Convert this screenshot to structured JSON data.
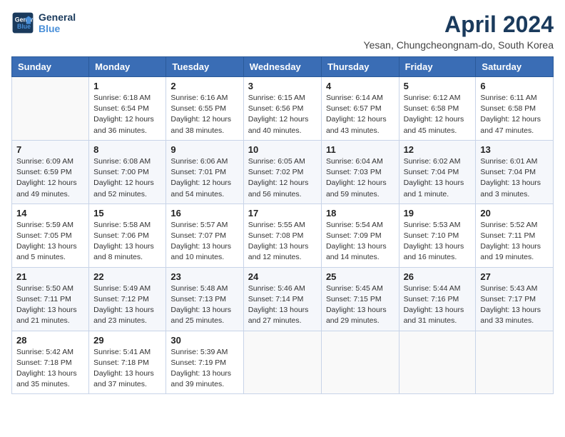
{
  "logo": {
    "line1": "General",
    "line2": "Blue"
  },
  "title": "April 2024",
  "subtitle": "Yesan, Chungcheongnam-do, South Korea",
  "days_of_week": [
    "Sunday",
    "Monday",
    "Tuesday",
    "Wednesday",
    "Thursday",
    "Friday",
    "Saturday"
  ],
  "weeks": [
    [
      {
        "num": "",
        "info": ""
      },
      {
        "num": "1",
        "info": "Sunrise: 6:18 AM\nSunset: 6:54 PM\nDaylight: 12 hours\nand 36 minutes."
      },
      {
        "num": "2",
        "info": "Sunrise: 6:16 AM\nSunset: 6:55 PM\nDaylight: 12 hours\nand 38 minutes."
      },
      {
        "num": "3",
        "info": "Sunrise: 6:15 AM\nSunset: 6:56 PM\nDaylight: 12 hours\nand 40 minutes."
      },
      {
        "num": "4",
        "info": "Sunrise: 6:14 AM\nSunset: 6:57 PM\nDaylight: 12 hours\nand 43 minutes."
      },
      {
        "num": "5",
        "info": "Sunrise: 6:12 AM\nSunset: 6:58 PM\nDaylight: 12 hours\nand 45 minutes."
      },
      {
        "num": "6",
        "info": "Sunrise: 6:11 AM\nSunset: 6:58 PM\nDaylight: 12 hours\nand 47 minutes."
      }
    ],
    [
      {
        "num": "7",
        "info": "Sunrise: 6:09 AM\nSunset: 6:59 PM\nDaylight: 12 hours\nand 49 minutes."
      },
      {
        "num": "8",
        "info": "Sunrise: 6:08 AM\nSunset: 7:00 PM\nDaylight: 12 hours\nand 52 minutes."
      },
      {
        "num": "9",
        "info": "Sunrise: 6:06 AM\nSunset: 7:01 PM\nDaylight: 12 hours\nand 54 minutes."
      },
      {
        "num": "10",
        "info": "Sunrise: 6:05 AM\nSunset: 7:02 PM\nDaylight: 12 hours\nand 56 minutes."
      },
      {
        "num": "11",
        "info": "Sunrise: 6:04 AM\nSunset: 7:03 PM\nDaylight: 12 hours\nand 59 minutes."
      },
      {
        "num": "12",
        "info": "Sunrise: 6:02 AM\nSunset: 7:04 PM\nDaylight: 13 hours\nand 1 minute."
      },
      {
        "num": "13",
        "info": "Sunrise: 6:01 AM\nSunset: 7:04 PM\nDaylight: 13 hours\nand 3 minutes."
      }
    ],
    [
      {
        "num": "14",
        "info": "Sunrise: 5:59 AM\nSunset: 7:05 PM\nDaylight: 13 hours\nand 5 minutes."
      },
      {
        "num": "15",
        "info": "Sunrise: 5:58 AM\nSunset: 7:06 PM\nDaylight: 13 hours\nand 8 minutes."
      },
      {
        "num": "16",
        "info": "Sunrise: 5:57 AM\nSunset: 7:07 PM\nDaylight: 13 hours\nand 10 minutes."
      },
      {
        "num": "17",
        "info": "Sunrise: 5:55 AM\nSunset: 7:08 PM\nDaylight: 13 hours\nand 12 minutes."
      },
      {
        "num": "18",
        "info": "Sunrise: 5:54 AM\nSunset: 7:09 PM\nDaylight: 13 hours\nand 14 minutes."
      },
      {
        "num": "19",
        "info": "Sunrise: 5:53 AM\nSunset: 7:10 PM\nDaylight: 13 hours\nand 16 minutes."
      },
      {
        "num": "20",
        "info": "Sunrise: 5:52 AM\nSunset: 7:11 PM\nDaylight: 13 hours\nand 19 minutes."
      }
    ],
    [
      {
        "num": "21",
        "info": "Sunrise: 5:50 AM\nSunset: 7:11 PM\nDaylight: 13 hours\nand 21 minutes."
      },
      {
        "num": "22",
        "info": "Sunrise: 5:49 AM\nSunset: 7:12 PM\nDaylight: 13 hours\nand 23 minutes."
      },
      {
        "num": "23",
        "info": "Sunrise: 5:48 AM\nSunset: 7:13 PM\nDaylight: 13 hours\nand 25 minutes."
      },
      {
        "num": "24",
        "info": "Sunrise: 5:46 AM\nSunset: 7:14 PM\nDaylight: 13 hours\nand 27 minutes."
      },
      {
        "num": "25",
        "info": "Sunrise: 5:45 AM\nSunset: 7:15 PM\nDaylight: 13 hours\nand 29 minutes."
      },
      {
        "num": "26",
        "info": "Sunrise: 5:44 AM\nSunset: 7:16 PM\nDaylight: 13 hours\nand 31 minutes."
      },
      {
        "num": "27",
        "info": "Sunrise: 5:43 AM\nSunset: 7:17 PM\nDaylight: 13 hours\nand 33 minutes."
      }
    ],
    [
      {
        "num": "28",
        "info": "Sunrise: 5:42 AM\nSunset: 7:18 PM\nDaylight: 13 hours\nand 35 minutes."
      },
      {
        "num": "29",
        "info": "Sunrise: 5:41 AM\nSunset: 7:18 PM\nDaylight: 13 hours\nand 37 minutes."
      },
      {
        "num": "30",
        "info": "Sunrise: 5:39 AM\nSunset: 7:19 PM\nDaylight: 13 hours\nand 39 minutes."
      },
      {
        "num": "",
        "info": ""
      },
      {
        "num": "",
        "info": ""
      },
      {
        "num": "",
        "info": ""
      },
      {
        "num": "",
        "info": ""
      }
    ]
  ]
}
